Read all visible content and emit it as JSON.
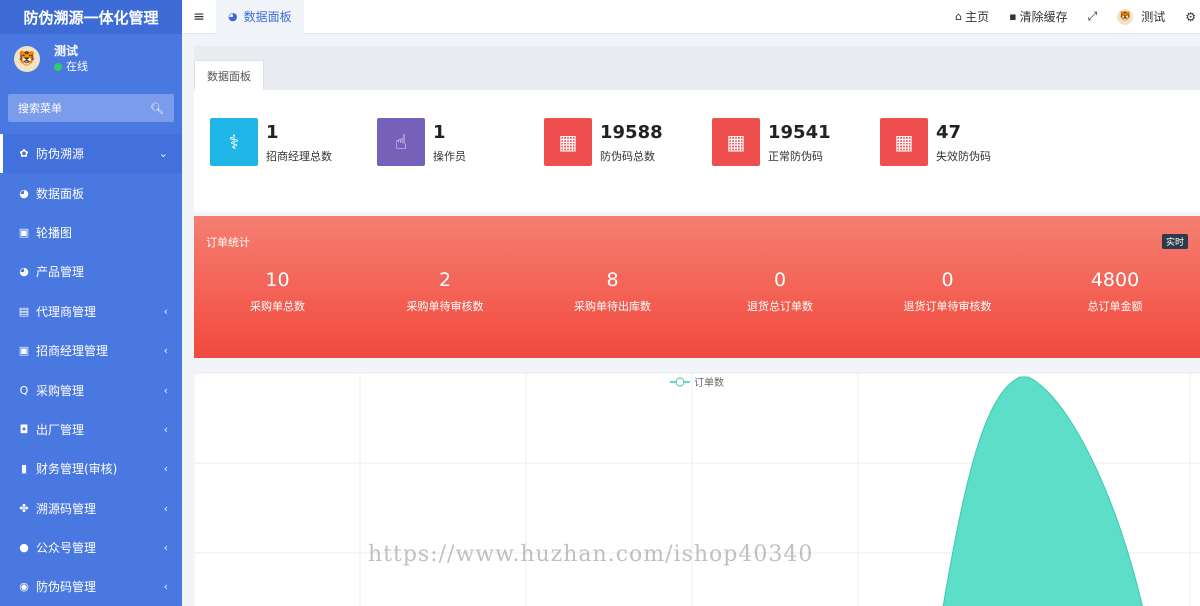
{
  "app": {
    "title": "防伪溯源一体化管理"
  },
  "user": {
    "name": "测试",
    "status": "在线"
  },
  "sidebar": {
    "search_placeholder": "搜索菜单",
    "items": [
      {
        "label": "防伪溯源",
        "icon": "✿",
        "icon_name": "flower-icon",
        "chevron": "⌄"
      },
      {
        "label": "数据面板",
        "icon": "◕",
        "icon_name": "dashboard-icon",
        "chevron": ""
      },
      {
        "label": "轮播图",
        "icon": "▣",
        "icon_name": "image-icon",
        "chevron": ""
      },
      {
        "label": "产品管理",
        "icon": "◕",
        "icon_name": "dashboard-icon",
        "chevron": ""
      },
      {
        "label": "代理商管理",
        "icon": "▤",
        "icon_name": "id-card-icon",
        "chevron": "‹"
      },
      {
        "label": "招商经理管理",
        "icon": "▣",
        "icon_name": "contact-card-icon",
        "chevron": "‹"
      },
      {
        "label": "采购管理",
        "icon": "Q",
        "icon_name": "search-icon",
        "chevron": "‹"
      },
      {
        "label": "出厂管理",
        "icon": "◘",
        "icon_name": "inbox-icon",
        "chevron": "‹"
      },
      {
        "label": "财务管理(审核)",
        "icon": "▮",
        "icon_name": "info-icon",
        "chevron": "‹"
      },
      {
        "label": "溯源码管理",
        "icon": "✤",
        "icon_name": "cubes-icon",
        "chevron": "‹"
      },
      {
        "label": "公众号管理",
        "icon": "●",
        "icon_name": "wechat-icon",
        "chevron": "‹"
      },
      {
        "label": "防伪码管理",
        "icon": "◉",
        "icon_name": "shield-icon",
        "chevron": "‹"
      }
    ]
  },
  "topbar": {
    "tab_label": "数据面板",
    "home": "主页",
    "clear_cache": "清除缓存",
    "user_name": "测试"
  },
  "panel": {
    "tab_label": "数据面板"
  },
  "stats": [
    {
      "value": "1",
      "label": "招商经理总数",
      "color": "#1fb5e6",
      "icon": "user-doctor-icon"
    },
    {
      "value": "1",
      "label": "操作员",
      "color": "#7560ba",
      "icon": "hand-pointer-icon"
    },
    {
      "value": "19588",
      "label": "防伪码总数",
      "color": "#ef4f4f",
      "icon": "qrcode-icon"
    },
    {
      "value": "19541",
      "label": "正常防伪码",
      "color": "#ef4f4f",
      "icon": "qrcode-icon"
    },
    {
      "value": "47",
      "label": "失效防伪码",
      "color": "#ef4f4f",
      "icon": "qrcode-icon"
    }
  ],
  "orders": {
    "title": "订单统计",
    "badge": "实时",
    "items": [
      {
        "value": "10",
        "label": "采购单总数"
      },
      {
        "value": "2",
        "label": "采购单待审核数"
      },
      {
        "value": "8",
        "label": "采购单待出库数"
      },
      {
        "value": "0",
        "label": "退货总订单数"
      },
      {
        "value": "0",
        "label": "退货订单待审核数"
      },
      {
        "value": "4800",
        "label": "总订单金额"
      }
    ]
  },
  "chart_data": {
    "type": "area",
    "series": [
      {
        "name": "订单数",
        "color": "#5ddec8"
      }
    ],
    "grid": true,
    "legend": "top-center"
  },
  "watermark": "https://www.huzhan.com/ishop40340"
}
